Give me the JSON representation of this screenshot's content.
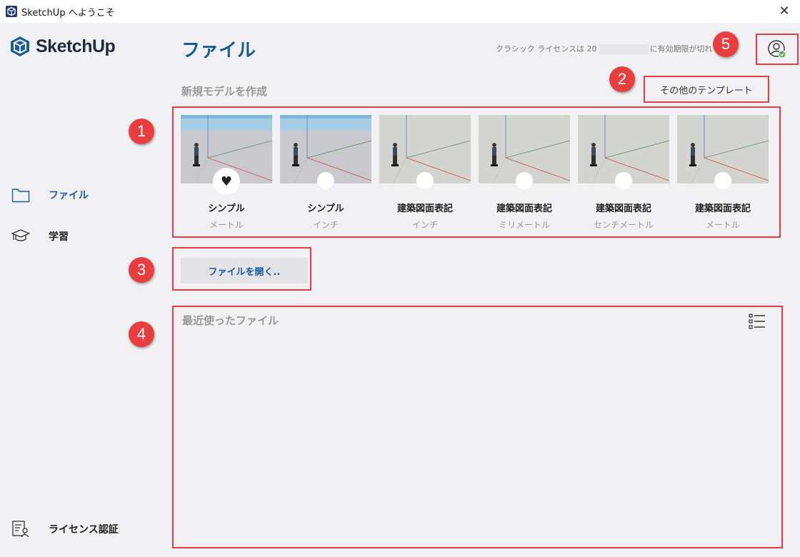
{
  "window": {
    "title": "SketchUp へようこそ",
    "close_glyph": "✕"
  },
  "brand": {
    "logo_text": "SketchUp",
    "accent": "#1b5d98"
  },
  "sidebar": {
    "items": [
      {
        "label": "ファイル",
        "icon": "folder-icon",
        "active": true
      },
      {
        "label": "学習",
        "icon": "graduation-cap-icon",
        "active": false
      }
    ],
    "footer": {
      "label": "ライセンス認証",
      "icon": "license-icon"
    }
  },
  "header": {
    "title": "ファイル",
    "license_prefix": "クラシック ライセンスは 20",
    "license_suffix": "に有効期限が切れ"
  },
  "new_model": {
    "heading": "新規モデルを作成",
    "more_templates": "その他のテンプレート",
    "templates": [
      {
        "name": "シンプル",
        "unit": "メートル",
        "favorite": true,
        "sky": true
      },
      {
        "name": "シンプル",
        "unit": "インチ",
        "favorite": false,
        "sky": true
      },
      {
        "name": "建築図面表記",
        "unit": "インチ",
        "favorite": false,
        "sky": false
      },
      {
        "name": "建築図面表記",
        "unit": "ミリメートル",
        "favorite": false,
        "sky": false
      },
      {
        "name": "建築図面表記",
        "unit": "センチメートル",
        "favorite": false,
        "sky": false
      },
      {
        "name": "建築図面表記",
        "unit": "メートル",
        "favorite": false,
        "sky": false
      }
    ]
  },
  "open_file": {
    "label": "ファイルを開く.."
  },
  "recent": {
    "heading": "最近使ったファイル"
  },
  "callouts": [
    "1",
    "2",
    "3",
    "4",
    "5"
  ]
}
